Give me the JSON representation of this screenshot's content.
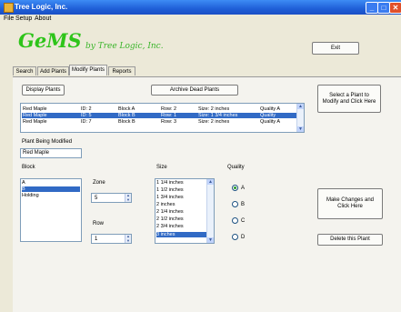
{
  "window": {
    "title": "Tree Logic, Inc.",
    "min_glyph": "_",
    "max_glyph": "□",
    "close_glyph": "✕"
  },
  "menu": [
    "File",
    "Setup",
    "About"
  ],
  "logo": {
    "name": "GeMS",
    "tagline": "by Tree Logic, Inc."
  },
  "exit_label": "Exit",
  "tabs": [
    {
      "label": "Search",
      "active": false
    },
    {
      "label": "Add Plants",
      "active": false
    },
    {
      "label": "Modify Plants",
      "active": true
    },
    {
      "label": "Reports",
      "active": false
    }
  ],
  "buttons": {
    "display_plants": "Display Plants",
    "archive_dead": "Archive Dead Plants",
    "select_plant": "Select a Plant to Modify and Click Here",
    "make_changes": "Make Changes and Click Here",
    "delete_plant": "Delete this Plant"
  },
  "plants": [
    {
      "name": "Red Maple",
      "id": "ID: 2",
      "block": "Block   A",
      "row": "Row:  2",
      "size": "Size: 2 inches",
      "quality": "Quality   A",
      "selected": false
    },
    {
      "name": "Red Maple",
      "id": "ID: 5",
      "block": "Block   B",
      "row": "Row:  1",
      "size": "Size: 1 3/4 inches",
      "quality": "Quality",
      "selected": true
    },
    {
      "name": "Red Maple",
      "id": "ID: 7",
      "block": "Block   B",
      "row": "Row:  3",
      "size": "Size: 2 inches",
      "quality": "Quality   A",
      "selected": false
    }
  ],
  "modify": {
    "heading": "Plant Being Modified",
    "plant_value": "Red Maple",
    "block_label": "Block",
    "blocks": [
      {
        "label": "A",
        "selected": false
      },
      {
        "label": "B",
        "selected": true
      },
      {
        "label": "Holding",
        "selected": false
      }
    ],
    "zone_label": "Zone",
    "zone_value": "5",
    "row_label": "Row",
    "row_value": "1",
    "size_label": "Size",
    "sizes": [
      {
        "label": "1 1/4 inches",
        "selected": false
      },
      {
        "label": "1 1/2 inches",
        "selected": false
      },
      {
        "label": "1 3/4 inches",
        "selected": false
      },
      {
        "label": "2 inches",
        "selected": false
      },
      {
        "label": "2 1/4 inches",
        "selected": false
      },
      {
        "label": "2 1/2 inches",
        "selected": false
      },
      {
        "label": "2 3/4 inches",
        "selected": false
      },
      {
        "label": "3 inches",
        "selected": true
      }
    ],
    "quality_label": "Quality",
    "quality_options": [
      {
        "label": "A",
        "checked": true
      },
      {
        "label": "B",
        "checked": false
      },
      {
        "label": "C",
        "checked": false
      },
      {
        "label": "D",
        "checked": false
      }
    ]
  },
  "colors": {
    "titlebar": "#1f5fd8",
    "selection": "#316ac5",
    "logo_green": "#2ec41a"
  }
}
